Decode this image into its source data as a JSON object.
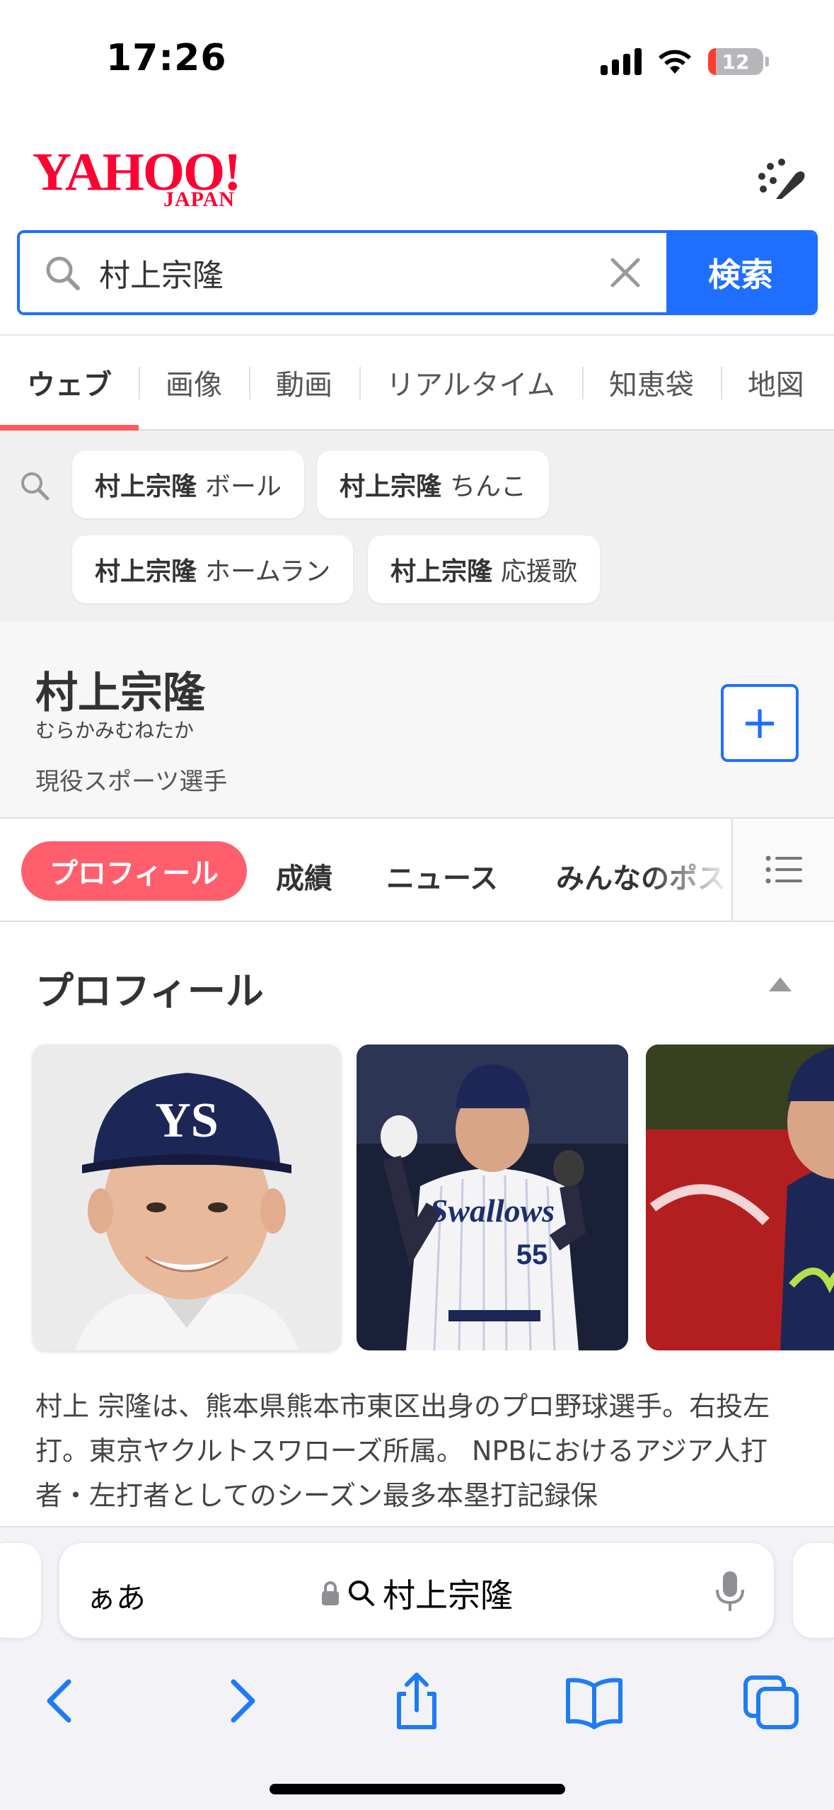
{
  "status_bar": {
    "time": "17:26",
    "battery": "12"
  },
  "brand": {
    "logo": "YAHOO!",
    "logo_sub": "JAPAN"
  },
  "search": {
    "value": "村上宗隆",
    "button": "検索"
  },
  "tabs": [
    "ウェブ",
    "画像",
    "動画",
    "リアルタイム",
    "知恵袋",
    "地図"
  ],
  "suggestions": [
    {
      "bold": "村上宗隆",
      "rest": "ボール"
    },
    {
      "bold": "村上宗隆",
      "rest": "ちんこ"
    },
    {
      "bold": "村上宗隆",
      "rest": "ホームラン"
    },
    {
      "bold": "村上宗隆",
      "rest": "応援歌"
    }
  ],
  "entity": {
    "name": "村上宗隆",
    "reading": "むらかみむねたか",
    "category": "現役スポーツ選手",
    "add": "+"
  },
  "subnav": {
    "active": "プロフィール",
    "items": [
      "成績",
      "ニュース",
      "みんなのポス"
    ]
  },
  "profile": {
    "heading": "プロフィール",
    "photo2_text": "Swallows",
    "photo2_number": "55",
    "description": "村上 宗隆は、熊本県熊本市東区出身のプロ野球選手。右投左打。東京ヤクルトスワローズ所属。 NPBにおけるアジア人打者・左打者としてのシーズン最多本塁打記録保"
  },
  "safari": {
    "aa": "ぁあ",
    "url": "村上宗隆"
  },
  "colors": {
    "brand_red": "#ff0033",
    "accent_blue": "#1e6fff",
    "active_pink": "#ff5f6d"
  },
  "icons": [
    "search-icon",
    "clear-icon",
    "menu-icon",
    "plus-icon",
    "list-icon",
    "lock-icon",
    "mic-icon",
    "back-icon",
    "forward-icon",
    "share-icon",
    "bookmarks-icon",
    "tabs-icon"
  ]
}
